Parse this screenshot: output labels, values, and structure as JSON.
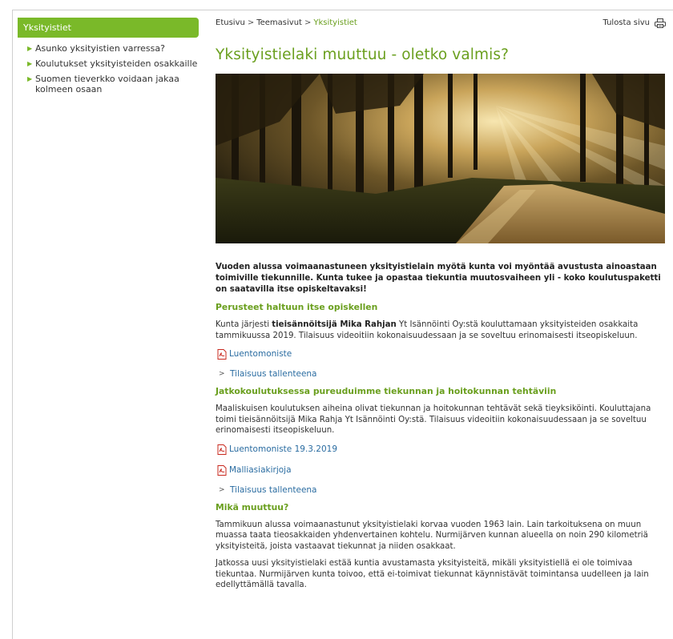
{
  "sidebar": {
    "title": "Yksityistiet",
    "items": [
      {
        "label": "Asunko yksityistien varressa?"
      },
      {
        "label": "Koulutukset yksityisteiden osakkaille"
      },
      {
        "label": "Suomen tieverkko voidaan jakaa kolmeen osaan"
      }
    ]
  },
  "breadcrumb": {
    "home": "Etusivu",
    "section": "Teemasivut",
    "current": "Yksityistiet",
    "separator": ">"
  },
  "print": {
    "label": "Tulosta sivu",
    "icon": "printer-icon"
  },
  "article": {
    "title": "Yksityistielaki muuttuu - oletko valmis?",
    "lead": "Vuoden alussa voimaanastuneen yksityistielain myötä kunta voi myöntää avustusta ainoastaan toimiville tiekunnille. Kunta tukee ja opastaa tiekuntia muutosvaiheen yli - koko koulutuspaketti on saatavilla itse opiskeltavaksi!",
    "section1": {
      "heading": "Perusteet haltuun itse opiskellen",
      "text_before": "Kunta järjesti ",
      "text_bold": "tieisännöitsijä Mika Rahjan",
      "text_after": " Yt Isännöinti Oy:stä kouluttamaan yksityisteiden osakkaita tammikuussa 2019. Tilaisuus videoitiin kokonaisuudessaan ja se soveltuu erinomaisesti itseopiskeluun.",
      "pdf_link": "Luentomoniste",
      "recording_link": "Tilaisuus tallenteena"
    },
    "section2": {
      "heading": "Jatkokoulutuksessa pureuduimme tiekunnan ja hoitokunnan tehtäviin",
      "text": "Maaliskuisen koulutuksen aiheina olivat tiekunnan ja hoitokunnan tehtävät sekä tieyksiköinti. Kouluttajana toimi tieisännöitsijä Mika Rahja Yt Isännöinti Oy:stä. Tilaisuus videoitiin kokonaisuudessaan ja se soveltuu erinomaisesti itseopiskeluun.",
      "pdf_link_1": "Luentomoniste 19.3.2019",
      "pdf_link_2": "Malliasiakirjoja",
      "recording_link": "Tilaisuus tallenteena"
    },
    "section3": {
      "heading": "Mikä muuttuu?",
      "text1": "Tammikuun alussa voimaanastunut yksityistielaki korvaa vuoden 1963 lain. Lain tarkoituksena on muun muassa taata tieosakkaiden yhdenvertainen kohtelu. Nurmijärven kunnan alueella on noin 290 kilometriä yksityisteitä, joista vastaavat tiekunnat ja niiden osakkaat.",
      "text2": "Jatkossa uusi yksityistielaki estää kuntia avustamasta yksityisteitä, mikäli yksityistiellä ei ole toimivaa tiekuntaa. Nurmijärven kunta toivoo, että ei-toimivat tiekunnat käynnistävät toimintansa uudelleen ja lain edellyttämällä tavalla."
    }
  },
  "colors": {
    "accent_green": "#7ab929",
    "heading_green": "#6a9f1e",
    "link_blue": "#2a6ca1",
    "pdf_red": "#c8281e"
  },
  "icons": {
    "pdf": "pdf-icon",
    "bullet": "triangle-right-icon",
    "chevron": "chevron-right-icon"
  }
}
